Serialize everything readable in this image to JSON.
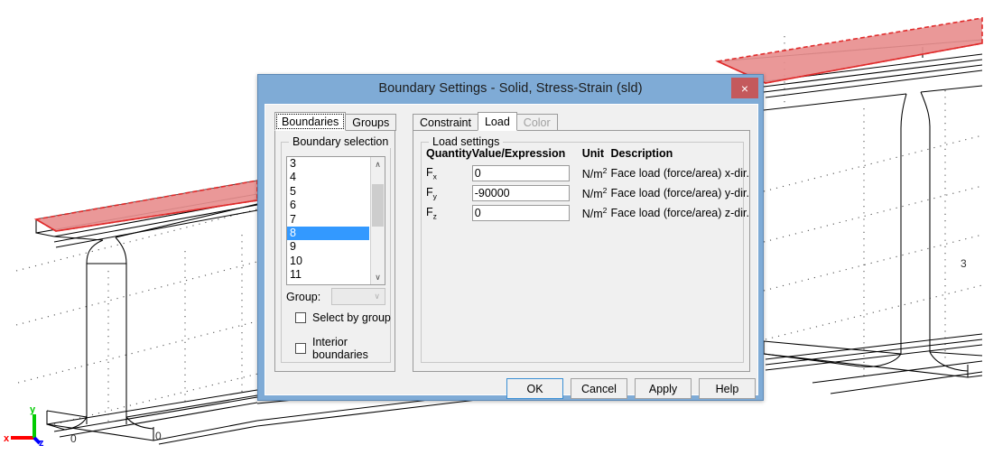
{
  "viewport": {
    "axes": [
      {
        "name": "x-axis",
        "label": "x",
        "color": "#ff0000"
      },
      {
        "name": "y-axis",
        "label": "y",
        "color": "#00cc00"
      },
      {
        "name": "z-axis",
        "label": "z",
        "color": "#0000ff"
      }
    ],
    "dimension_labels": [
      "0",
      "0"
    ],
    "face_label": "3",
    "selected_face_fill": "#e88f8f",
    "selected_face_stroke": "#e02b2b"
  },
  "dialog": {
    "title": "Boundary Settings - Solid, Stress-Strain (sld)",
    "close_label": "×",
    "left_tabs": [
      {
        "label": "Boundaries",
        "selected": true,
        "focused": true,
        "disabled": false
      },
      {
        "label": "Groups",
        "selected": false,
        "focused": false,
        "disabled": false
      }
    ],
    "right_tabs": [
      {
        "label": "Constraint",
        "selected": false,
        "focused": false,
        "disabled": false
      },
      {
        "label": "Load",
        "selected": true,
        "focused": false,
        "disabled": false
      },
      {
        "label": "Color",
        "selected": false,
        "focused": false,
        "disabled": true
      }
    ],
    "boundary_selection": {
      "group_title": "Boundary selection",
      "items": [
        {
          "label": "3",
          "selected": false
        },
        {
          "label": "4",
          "selected": false
        },
        {
          "label": "5",
          "selected": false
        },
        {
          "label": "6",
          "selected": false
        },
        {
          "label": "7",
          "selected": false
        },
        {
          "label": "8",
          "selected": true
        },
        {
          "label": "9",
          "selected": false
        },
        {
          "label": "10",
          "selected": false
        },
        {
          "label": "11",
          "selected": false
        }
      ],
      "scroll_up_glyph": "∧",
      "scroll_down_glyph": "∨",
      "group_label": "Group:",
      "group_value": "",
      "group_chevron": "∨",
      "select_by_group_label": "Select by group",
      "select_by_group_checked": false,
      "interior_boundaries_label": "Interior boundaries",
      "interior_boundaries_checked": false
    },
    "load_settings": {
      "group_title": "Load settings",
      "headers": {
        "quantity": "Quantity",
        "value": "Value/Expression",
        "unit": "Unit",
        "description": "Description"
      },
      "rows": [
        {
          "quantity_base": "F",
          "quantity_sub": "x",
          "value": "0",
          "unit_base": "N/m",
          "unit_sup": "2",
          "description": "Face load (force/area) x-dir."
        },
        {
          "quantity_base": "F",
          "quantity_sub": "y",
          "value": "-90000",
          "unit_base": "N/m",
          "unit_sup": "2",
          "description": "Face load (force/area) y-dir."
        },
        {
          "quantity_base": "F",
          "quantity_sub": "z",
          "value": "0",
          "unit_base": "N/m",
          "unit_sup": "2",
          "description": "Face load (force/area) z-dir."
        }
      ]
    },
    "buttons": {
      "ok": "OK",
      "cancel": "Cancel",
      "apply": "Apply",
      "help": "Help"
    }
  }
}
